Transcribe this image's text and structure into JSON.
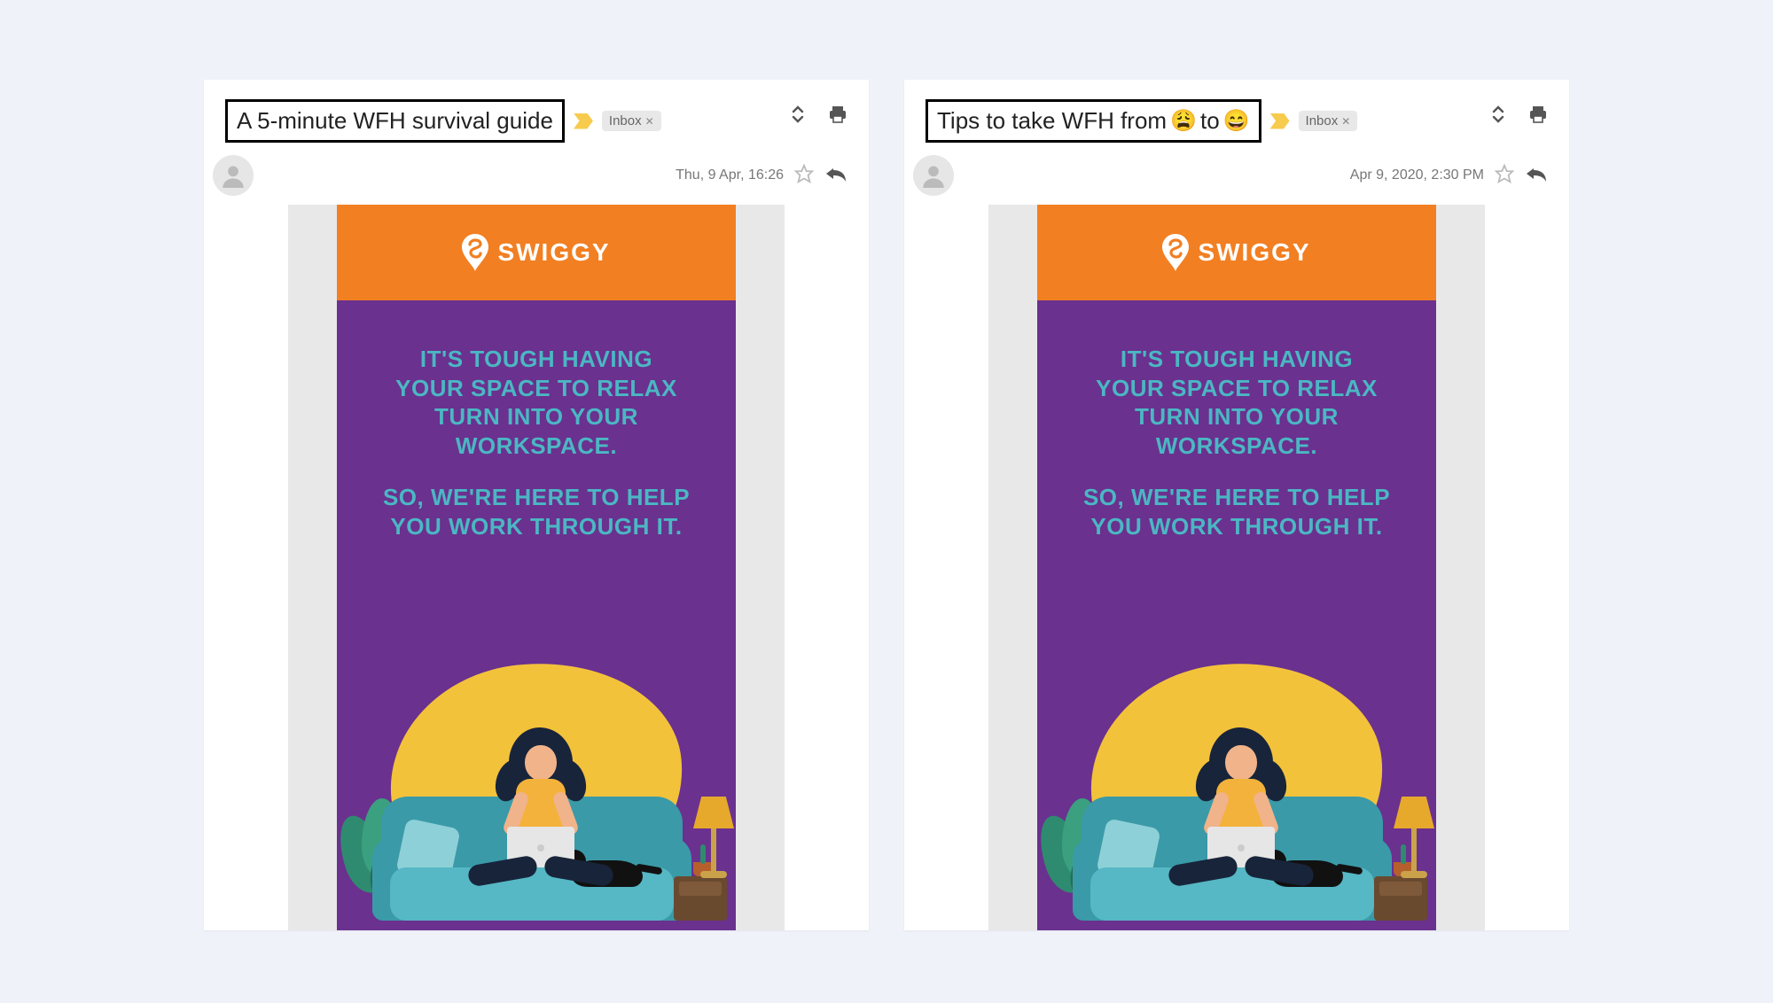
{
  "emails": [
    {
      "subject": "A 5-minute WFH survival guide",
      "subject_emoji1": "",
      "subject_emoji2": "",
      "label": "Inbox",
      "timestamp": "Thu, 9 Apr, 16:26",
      "show_important_before_label": true,
      "brand": "SWIGGY",
      "body_line1": "IT'S TOUGH HAVING",
      "body_line2": "YOUR SPACE TO RELAX",
      "body_line3": "TURN INTO YOUR WORKSPACE.",
      "body_line4": "SO, WE'RE HERE TO HELP",
      "body_line5": "YOU WORK THROUGH IT."
    },
    {
      "subject": "Tips to take WFH from ",
      "subject_emoji1": "😩",
      "subject_middle": " to ",
      "subject_emoji2": "😄",
      "label": "Inbox",
      "timestamp": "Apr 9, 2020, 2:30 PM",
      "show_important_before_label": false,
      "brand": "SWIGGY",
      "body_line1": "IT'S TOUGH HAVING",
      "body_line2": "YOUR SPACE TO RELAX",
      "body_line3": "TURN INTO YOUR WORKSPACE.",
      "body_line4": "SO, WE'RE HERE TO HELP",
      "body_line5": "YOU WORK THROUGH IT."
    }
  ],
  "colors": {
    "page_bg": "#f0f2fa",
    "swiggy_orange": "#f27f22",
    "purple": "#6a318f",
    "headline_teal": "#4bb7c3"
  }
}
